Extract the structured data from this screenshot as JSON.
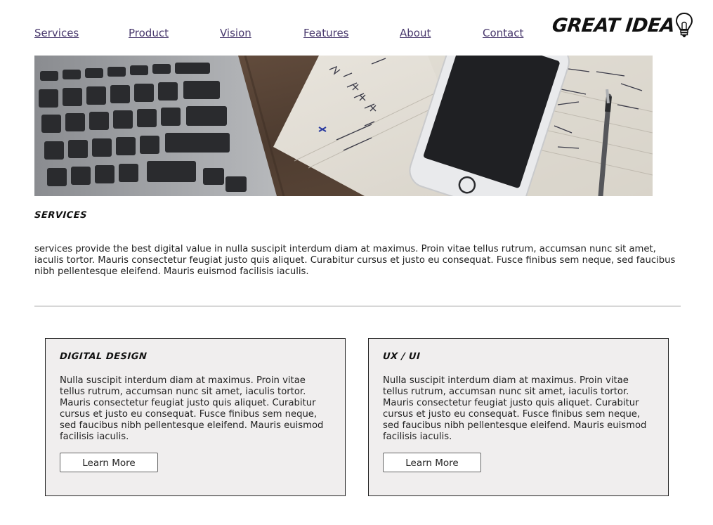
{
  "nav": {
    "items": [
      {
        "label": "Services"
      },
      {
        "label": "Product"
      },
      {
        "label": "Vision"
      },
      {
        "label": "Features"
      },
      {
        "label": "About"
      },
      {
        "label": "Contact"
      }
    ]
  },
  "logo": {
    "text": "GREAT IDEA",
    "icon": "lightbulb-icon"
  },
  "hero": {
    "image": "laptop-phone-notebook-photo"
  },
  "services": {
    "heading": "Services",
    "body": "services provide the best digital value in nulla suscipit interdum diam at maximus. Proin vitae tellus rutrum, accumsan nunc sit amet, iaculis tortor. Mauris consectetur feugiat justo quis aliquet. Curabitur cursus et justo eu consequat. Fusce finibus sem neque, sed faucibus nibh pellentesque eleifend. Mauris euismod facilisis iaculis."
  },
  "cards": [
    {
      "title": "Digital Design",
      "text": "Nulla suscipit interdum diam at maximus. Proin vitae tellus rutrum, accumsan nunc sit amet, iaculis tortor. Mauris consectetur feugiat justo quis aliquet. Curabitur cursus et justo eu consequat. Fusce finibus sem neque, sed faucibus nibh pellentesque eleifend. Mauris euismod facilisis iaculis.",
      "button": "Learn More"
    },
    {
      "title": "UX / UI",
      "text": "Nulla suscipit interdum diam at maximus. Proin vitae tellus rutrum, accumsan nunc sit amet, iaculis tortor. Mauris consectetur feugiat justo quis aliquet. Curabitur cursus et justo eu consequat. Fusce finibus sem neque, sed faucibus nibh pellentesque eleifend. Mauris euismod facilisis iaculis.",
      "button": "Learn More"
    }
  ],
  "colors": {
    "nav_link": "#4a3a6e",
    "card_bg": "#f0eeee",
    "divider": "#999999"
  }
}
